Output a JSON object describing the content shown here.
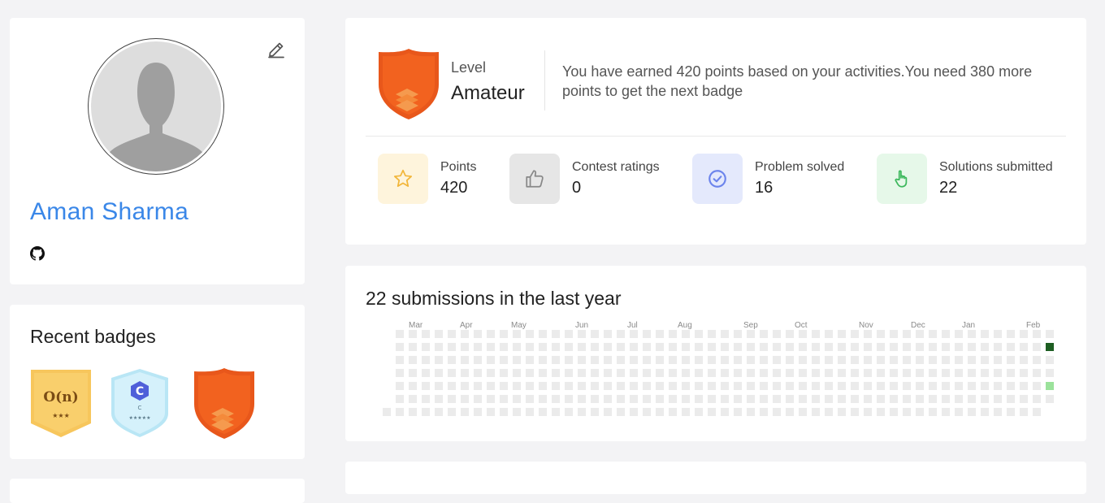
{
  "profile": {
    "name": "Aman Sharma",
    "edit_icon": "pencil-icon",
    "social_icon": "github-icon"
  },
  "badges": {
    "title": "Recent badges",
    "items": [
      {
        "name": "big-o-badge",
        "text": "O(n)",
        "stars": "★★★",
        "color": "#f7c65c"
      },
      {
        "name": "c-language-badge",
        "text": "C",
        "sub": "C",
        "stars": "★★★★★",
        "color": "#cdeef9"
      },
      {
        "name": "amateur-badge",
        "color": "#f2621f"
      }
    ]
  },
  "level": {
    "label": "Level",
    "value": "Amateur",
    "message": "You have earned 420 points based on your activities.You need 380 more points to get the next badge",
    "badge_color": "#f2621f"
  },
  "stats": [
    {
      "label": "Points",
      "value": "420",
      "icon": "star-icon",
      "bg": "#fef4dc",
      "fg": "#f2b63a"
    },
    {
      "label": "Contest ratings",
      "value": "0",
      "icon": "thumbs-up-icon",
      "bg": "#e6e6e6",
      "fg": "#888888"
    },
    {
      "label": "Problem solved",
      "value": "16",
      "icon": "check-circle-icon",
      "bg": "#e4e9fc",
      "fg": "#6c84ec"
    },
    {
      "label": "Solutions submitted",
      "value": "22",
      "icon": "pointing-hand-icon",
      "bg": "#e6f8e9",
      "fg": "#3cb85c"
    }
  ],
  "submissions": {
    "title": "22 submissions in the last year",
    "months": [
      "Mar",
      "Apr",
      "May",
      "Jun",
      "Jul",
      "Aug",
      "Sep",
      "Oct",
      "Nov",
      "Dec",
      "Jan",
      "Feb"
    ],
    "empty_color": "#ebebeb",
    "active_cells": [
      {
        "week": 51,
        "day": 1,
        "level": "high",
        "color": "#1d5e22"
      },
      {
        "week": 51,
        "day": 4,
        "level": "low",
        "color": "#9be29b"
      }
    ]
  }
}
